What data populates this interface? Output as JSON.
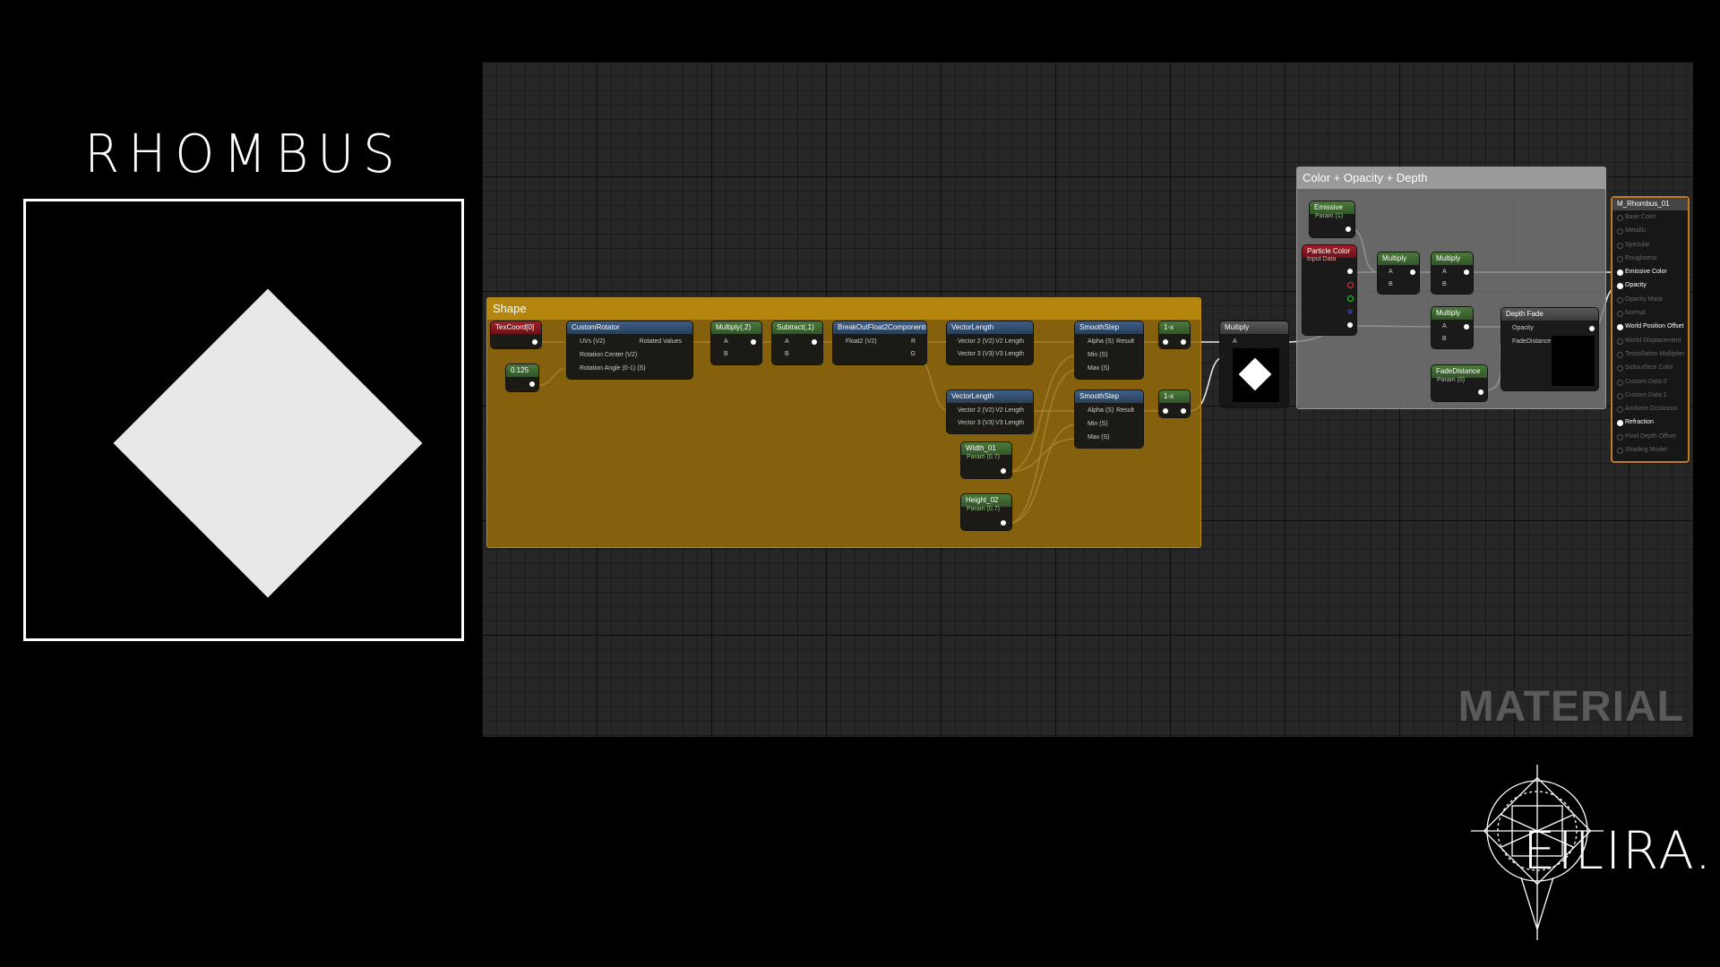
{
  "title": "RHOMBUS",
  "watermark": "MATERIAL",
  "brand": "EILIRA.M",
  "colors": {
    "shape_comment": "#b5860e",
    "color_comment": "#9a9a9a",
    "result_border": "#c07a22"
  },
  "comments": {
    "shape": "Shape",
    "color": "Color  + Opacity + Depth"
  },
  "nodes": {
    "texcoord": {
      "title": "TexCoord[0]"
    },
    "const_0125": {
      "title": "0.125"
    },
    "rotator": {
      "title": "CustomRotator",
      "in1": "UVs (V2)",
      "in2": "Rotation Center (V2)",
      "in3": "Rotation Angle (0-1) (S)",
      "out": "Rotated Values"
    },
    "multiply2": {
      "title": "Multiply(,2)",
      "a": "A",
      "b": "B"
    },
    "subtract1": {
      "title": "Subtract(,1)",
      "a": "A",
      "b": "B"
    },
    "breakout": {
      "title": "BreakOutFloat2Components",
      "in": "Float2 (V2)",
      "r": "R",
      "g": "G"
    },
    "vlen1": {
      "title": "VectorLength",
      "in1": "Vector 2 (V2)",
      "in2": "Vector 3 (V3)",
      "o1": "V2 Length",
      "o2": "V3 Length"
    },
    "vlen2": {
      "title": "VectorLength",
      "in1": "Vector 2 (V2)",
      "in2": "Vector 3 (V3)",
      "o1": "V2 Length",
      "o2": "V3 Length"
    },
    "width": {
      "title": "Width_01",
      "sub": "Param (0.7)"
    },
    "height": {
      "title": "Height_02",
      "sub": "Param (0.7)"
    },
    "smooth1": {
      "title": "SmoothStep",
      "a": "Alpha (S)",
      "min": "Min (S)",
      "max": "Max (S)",
      "out": "Result"
    },
    "smooth2": {
      "title": "SmoothStep",
      "a": "Alpha (S)",
      "min": "Min (S)",
      "max": "Max (S)",
      "out": "Result"
    },
    "oneminus1": {
      "title": "1-x"
    },
    "oneminus2": {
      "title": "1-x"
    },
    "multiply_main": {
      "title": "Multiply",
      "a": "A",
      "b": "B"
    },
    "emissive": {
      "title": "Emissive",
      "sub": "Param (1)"
    },
    "particle": {
      "title": "Particle Color",
      "sub": "Input Data"
    },
    "mult_a": {
      "title": "Multiply",
      "a": "A",
      "b": "B"
    },
    "mult_b": {
      "title": "Multiply",
      "a": "A",
      "b": "B"
    },
    "mult_c": {
      "title": "Multiply",
      "a": "A",
      "b": "B"
    },
    "depthfade": {
      "title": "Depth Fade",
      "in1": "Opacity",
      "in2": "FadeDistance"
    },
    "fadedist": {
      "title": "FadeDistance",
      "sub": "Param (0)"
    }
  },
  "result": {
    "title": "M_Rhombus_01",
    "pins": [
      {
        "label": "Base Color",
        "on": false
      },
      {
        "label": "Metallic",
        "on": false
      },
      {
        "label": "Specular",
        "on": false
      },
      {
        "label": "Roughness",
        "on": false
      },
      {
        "label": "Emissive Color",
        "on": true
      },
      {
        "label": "Opacity",
        "on": true
      },
      {
        "label": "Opacity Mask",
        "on": false
      },
      {
        "label": "Normal",
        "on": false
      },
      {
        "label": "World Position Offset",
        "on": true
      },
      {
        "label": "World Displacement",
        "on": false
      },
      {
        "label": "Tessellation Multiplier",
        "on": false
      },
      {
        "label": "Subsurface Color",
        "on": false
      },
      {
        "label": "Custom Data 0",
        "on": false
      },
      {
        "label": "Custom Data 1",
        "on": false
      },
      {
        "label": "Ambient Occlusion",
        "on": false
      },
      {
        "label": "Refraction",
        "on": true
      },
      {
        "label": "Pixel Depth Offset",
        "on": false
      },
      {
        "label": "Shading Model",
        "on": false
      }
    ]
  }
}
